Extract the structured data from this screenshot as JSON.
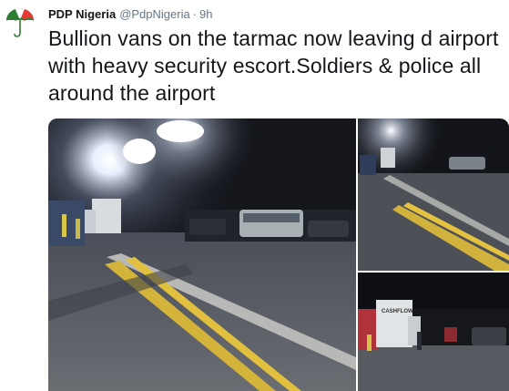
{
  "tweet": {
    "author_name": "PDP Nigeria",
    "handle": "@PdpNigeria",
    "separator": "·",
    "time": "9h",
    "text": "Bullion vans on the tarmac now leaving d airport with heavy security escort.Soldiers & police all around the airport"
  },
  "avatar": {
    "icon": "pdp-umbrella-logo-icon",
    "colors": [
      "#2e7d32",
      "#ffffff",
      "#e53935"
    ]
  },
  "media": {
    "photos": [
      {
        "name": "tarmac-night-photo",
        "scene": "airport tarmac at night, floodlight, vans and bus"
      },
      {
        "name": "tarmac-lines-photo",
        "scene": "tarmac with yellow lines under floodlights"
      },
      {
        "name": "bullion-van-photo",
        "scene": "white truck labeled CASHFLOW on tarmac"
      }
    ],
    "van_label": "CASHFLOW"
  }
}
